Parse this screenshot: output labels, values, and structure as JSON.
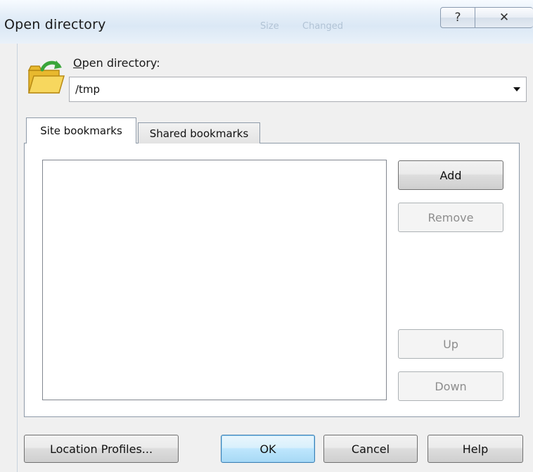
{
  "window": {
    "title": "Open directory",
    "ghost_title_1": "Size",
    "ghost_title_2": "Changed",
    "help_glyph": "?",
    "close_glyph": "✕"
  },
  "directory": {
    "label_mnemonic": "O",
    "label_rest": "pen directory:",
    "value": "/tmp",
    "icon": "folder-open-icon"
  },
  "tabs": [
    {
      "label": "Site bookmarks",
      "selected": true
    },
    {
      "label": "Shared bookmarks",
      "selected": false
    }
  ],
  "bookmarks": {
    "items": [],
    "buttons": {
      "add": "Add",
      "remove": "Remove",
      "up": "Up",
      "down": "Down"
    }
  },
  "footer": {
    "location_profiles": "Location Profiles...",
    "ok": "OK",
    "cancel": "Cancel",
    "help": "Help"
  },
  "colors": {
    "ok_accent": "#3c7fb1",
    "folder_yellow": "#f5d255",
    "folder_arrow_green": "#3aa53a"
  }
}
